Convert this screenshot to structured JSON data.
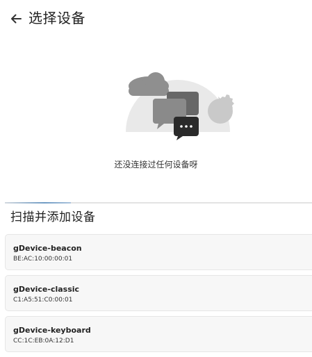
{
  "header": {
    "back_icon": "arrow-left-icon",
    "title": "选择设备"
  },
  "empty_state": {
    "illustration": "chat-bubbles-illustration",
    "message": "还没连接过任何设备呀"
  },
  "scan": {
    "progress_indicator": "indeterminate",
    "section_title": "扫描并添加设备"
  },
  "devices": [
    {
      "name": "gDevice-beacon",
      "address": "BE:AC:10:00:00:01"
    },
    {
      "name": "gDevice-classic",
      "address": "C1:A5:51:C0:00:01"
    },
    {
      "name": "gDevice-keyboard",
      "address": "CC:1C:EB:0A:12:D1"
    }
  ],
  "colors": {
    "accent": "#6f9bc4",
    "card_bg": "#f7f7f7",
    "illustration_gray": "#cfcfcf"
  }
}
